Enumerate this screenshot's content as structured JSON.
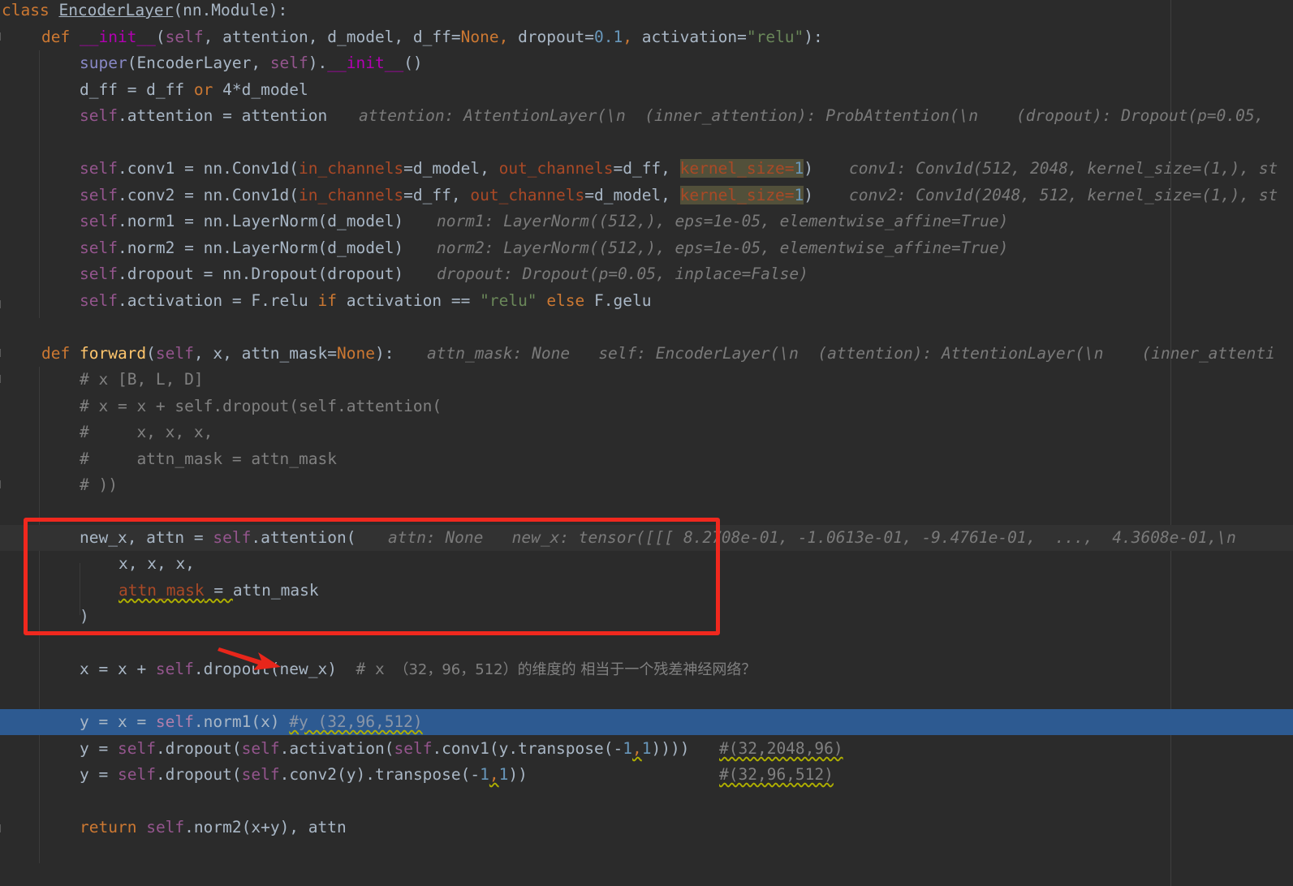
{
  "editor": {
    "language": "python",
    "lines": {
      "l1": {
        "kw": "class",
        "cls": "EncoderLayer",
        "rest": "(nn.Module):"
      },
      "l2": {
        "def": "def",
        "name": "__init__",
        "p1": "(",
        "self": "self",
        "c1": ", attention, d_model, ",
        "dff": "d_ff=",
        "none": "None",
        "c2": ", ",
        "dropout": "dropout=",
        "num": "0.1",
        "c3": ", ",
        "act": "activation=",
        "str": "\"relu\"",
        "end": "):"
      },
      "l3": {
        "super": "super",
        "a": "(EncoderLayer, ",
        "self": "self",
        "b": ").",
        "init": "__init__",
        "c": "()"
      },
      "l4": {
        "a": "d_ff = d_ff ",
        "or": "or",
        "b": " 4*d_model"
      },
      "l5": {
        "self": "self",
        "code": ".attention = attention",
        "hint": "attention: AttentionLayer(\\n  (inner_attention): ProbAttention(\\n    (dropout): Dropout(p=0.05,"
      },
      "l7": {
        "self": "self",
        "a": ".conv1 = nn.Conv1d(",
        "p1": "in_channels",
        "b": "=d_model, ",
        "p2": "out_channels",
        "c": "=d_ff, ",
        "p3": "kernel_size",
        "eq": "=",
        "n": "1",
        "d": ")",
        "hint": "conv1: Conv1d(512, 2048, kernel_size=(1,), st"
      },
      "l8": {
        "self": "self",
        "a": ".conv2 = nn.Conv1d(",
        "p1": "in_channels",
        "b": "=d_ff, ",
        "p2": "out_channels",
        "c": "=d_model, ",
        "p3": "kernel_size",
        "eq": "=",
        "n": "1",
        "d": ")",
        "hint": "conv2: Conv1d(2048, 512, kernel_size=(1,), st"
      },
      "l9": {
        "self": "self",
        "code": ".norm1 = nn.LayerNorm(d_model)",
        "hint": "norm1: LayerNorm((512,), eps=1e-05, elementwise_affine=True)"
      },
      "l10": {
        "self": "self",
        "code": ".norm2 = nn.LayerNorm(d_model)",
        "hint": "norm2: LayerNorm((512,), eps=1e-05, elementwise_affine=True)"
      },
      "l11": {
        "self": "self",
        "code": ".dropout = nn.Dropout(dropout)",
        "hint": "dropout: Dropout(p=0.05, inplace=False)"
      },
      "l12": {
        "self": "self",
        "a": ".activation = F.relu ",
        "if": "if",
        "b": " activation == ",
        "str": "\"relu\"",
        "c": " ",
        "else": "else",
        "d": " F.gelu"
      },
      "l14": {
        "def": "def",
        "name": "forward",
        "p1": "(",
        "self": "self",
        "a": ", x, attn_mask=",
        "none": "None",
        "b": "):",
        "hint": "attn_mask: None   self: EncoderLayer(\\n  (attention): AttentionLayer(\\n    (inner_attenti"
      },
      "l15": {
        "cm": "# x [B, L, D]"
      },
      "l16": {
        "cm": "# x = x + self.dropout(self.attention("
      },
      "l17": {
        "cm": "#     x, x, x,"
      },
      "l18": {
        "cm": "#     attn_mask = attn_mask"
      },
      "l19": {
        "cm": "# ))"
      },
      "l21": {
        "a": "new_x, attn = ",
        "self": "self",
        "b": ".attention(",
        "hint": "attn: None   new_x: tensor([[[ 8.2708e-01, -1.0613e-01, -9.4761e-01,  ...,  4.3608e-01,\\n"
      },
      "l22": {
        "a": "x, x, x,"
      },
      "l23": {
        "p": "attn_mask",
        "b": " = ",
        "c": "attn_mask"
      },
      "l24": {
        "a": ")"
      },
      "l26": {
        "a": "x = x + ",
        "self": "self",
        "b": ".dropout(new_x)",
        "cm": "  # x ",
        "cjk": "（32，96，512）的维度的 相当于一个残差神经网络？"
      },
      "l28": {
        "a": "y = x = ",
        "self": "self",
        "b": ".norm1(x) ",
        "cm": "#y (32,96,512)"
      },
      "l29": {
        "a": "y = ",
        "s1": "self",
        "b": ".dropout(",
        "s2": "self",
        "c": ".activation(",
        "s3": "self",
        "d": ".conv1(y.transpose(-",
        "n1": "1",
        "e": ",",
        "n2": "1",
        "f": "))))",
        "cm": "#(32,2048,96)"
      },
      "l30": {
        "a": "y = ",
        "s1": "self",
        "b": ".dropout(",
        "s2": "self",
        "c": ".conv2(y).transpose(-",
        "n1": "1",
        "e": ",",
        "n2": "1",
        "f": "))",
        "cm": "#(32,96,512)"
      },
      "l32": {
        "ret": "return",
        "sp": " ",
        "self": "self",
        "a": ".norm2(x+y), attn"
      }
    }
  }
}
